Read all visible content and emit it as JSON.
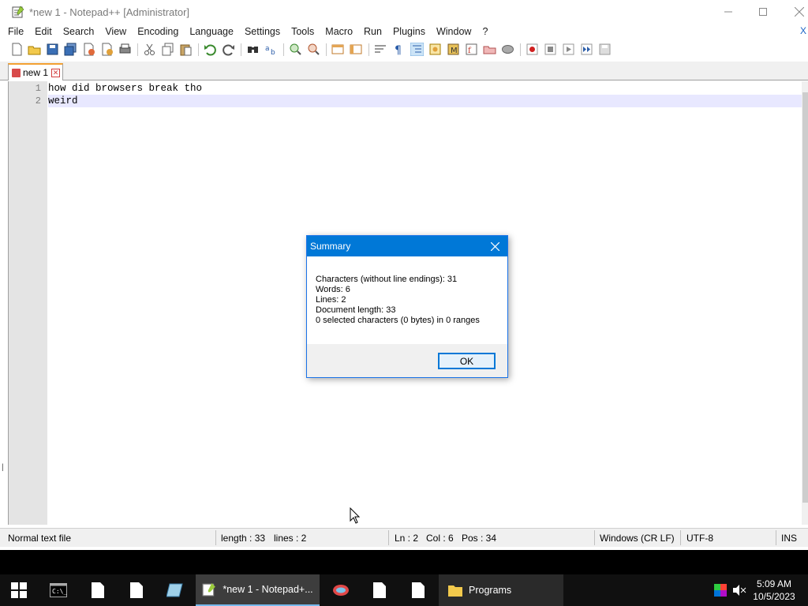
{
  "window": {
    "title": "*new 1 - Notepad++ [Administrator]"
  },
  "menu": [
    "File",
    "Edit",
    "Search",
    "View",
    "Encoding",
    "Language",
    "Settings",
    "Tools",
    "Macro",
    "Run",
    "Plugins",
    "Window",
    "?"
  ],
  "menu_close": "X",
  "tab": {
    "label": "new 1"
  },
  "editor": {
    "lines": [
      {
        "number": "1",
        "text": "how did browsers break tho"
      },
      {
        "number": "2",
        "text": "weird"
      }
    ]
  },
  "status": {
    "file_type": "Normal text file",
    "length": "length : 33",
    "lines": "lines : 2",
    "ln": "Ln : 2",
    "col": "Col : 6",
    "pos": "Pos : 34",
    "eol": "Windows (CR LF)",
    "encoding": "UTF-8",
    "mode": "INS"
  },
  "dialog": {
    "title": "Summary",
    "lines": [
      "Characters (without line endings): 31",
      "Words: 6",
      "Lines: 2",
      "Document length: 33",
      "0 selected characters (0 bytes) in 0 ranges"
    ],
    "ok_label": "OK"
  },
  "taskbar": {
    "notepad_label": "*new 1 - Notepad+...",
    "programs_label": "Programs",
    "time": "5:09 AM",
    "date": "10/5/2023"
  },
  "colors": {
    "dialog_title_bar": "#0078d7",
    "current_line": "#e8e8ff",
    "taskbar": "#101010",
    "tab_accent": "#f3a032"
  }
}
